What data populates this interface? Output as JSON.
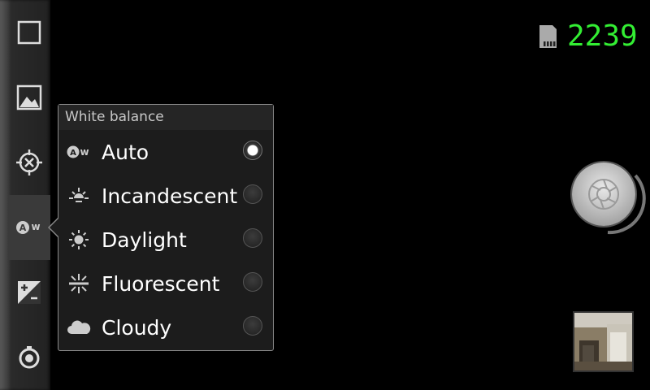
{
  "sidebar": {
    "buttons": [
      {
        "icon": "square-icon"
      },
      {
        "icon": "scene-mode-icon"
      },
      {
        "icon": "focus-icon"
      },
      {
        "icon": "white-balance-auto-icon"
      },
      {
        "icon": "exposure-icon"
      },
      {
        "icon": "camera-settings-icon"
      }
    ]
  },
  "popup": {
    "title": "White balance",
    "options": [
      {
        "label": "Auto",
        "icon": "white-balance-auto-icon",
        "checked": true
      },
      {
        "label": "Incandescent",
        "icon": "incandescent-icon",
        "checked": false
      },
      {
        "label": "Daylight",
        "icon": "daylight-icon",
        "checked": false
      },
      {
        "label": "Fluorescent",
        "icon": "fluorescent-icon",
        "checked": false
      },
      {
        "label": "Cloudy",
        "icon": "cloudy-icon",
        "checked": false
      }
    ]
  },
  "status": {
    "remaining_shots": "2239",
    "storage_icon": "sd-card-icon",
    "counter_color": "#33ee33"
  },
  "controls": {
    "shutter_icon": "shutter-icon",
    "thumbnail": "last-photo-thumbnail"
  }
}
